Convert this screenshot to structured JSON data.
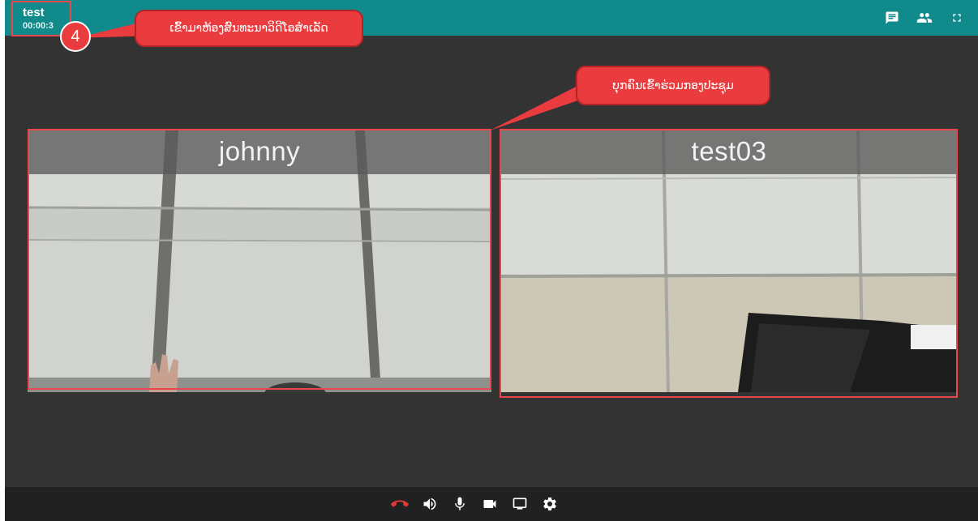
{
  "header": {
    "room_name": "test",
    "timer": "00:00:3"
  },
  "top_actions": [
    {
      "name": "chat-icon"
    },
    {
      "name": "participants-icon"
    },
    {
      "name": "fullscreen-icon"
    }
  ],
  "participants": [
    {
      "name": "johnny"
    },
    {
      "name": "test03"
    }
  ],
  "controls": [
    {
      "name": "hang-up-icon",
      "color": "#e53935"
    },
    {
      "name": "speaker-icon"
    },
    {
      "name": "microphone-icon"
    },
    {
      "name": "camera-icon"
    },
    {
      "name": "screen-share-icon"
    },
    {
      "name": "settings-icon"
    }
  ],
  "annotations": {
    "step_number": "4",
    "joined_callout": "ເຂົ້າມາຫ້ອງສົນທະນາວິດີໂອສຳເລັດ",
    "participants_callout": "ບຸກຄົນເຂົ້າຮ່ວມກອງປະຊຸມ"
  },
  "colors": {
    "topbar": "#118a8c",
    "background": "#333333",
    "bottombar": "#212121",
    "highlight": "#e8484b",
    "callout": "#ea3c3f"
  }
}
